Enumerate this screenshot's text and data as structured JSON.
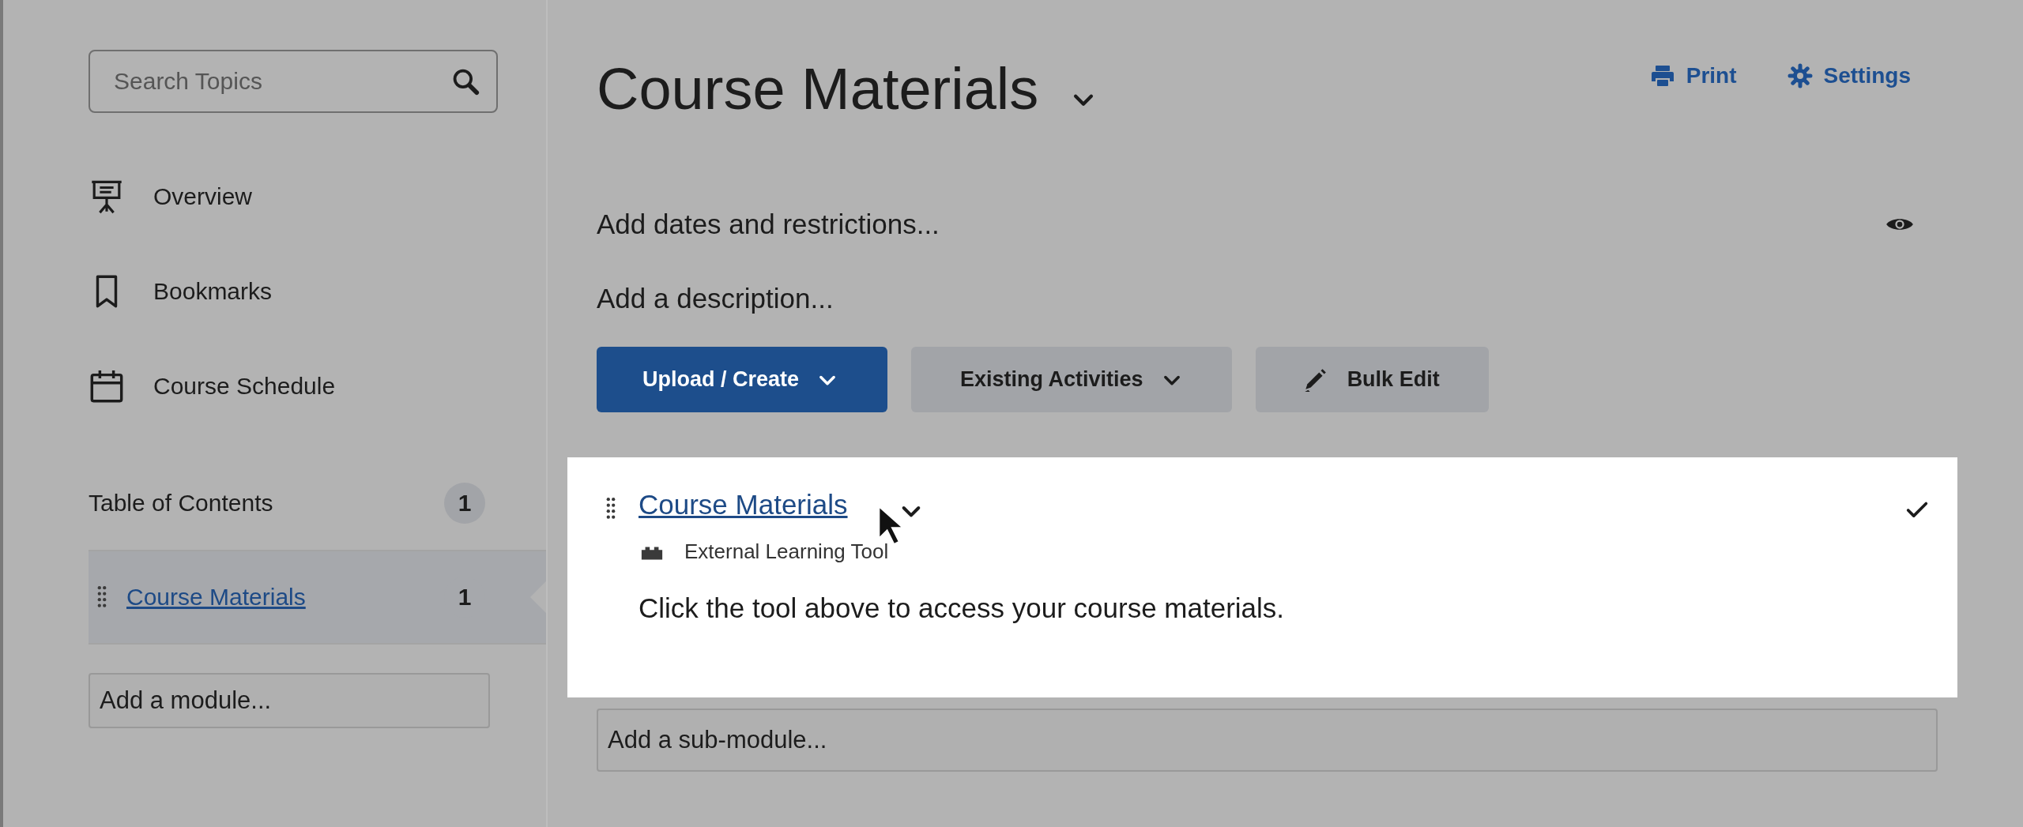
{
  "sidebar": {
    "search": {
      "placeholder": "Search Topics"
    },
    "nav_items": [
      {
        "kind": "overview",
        "label": "Overview"
      },
      {
        "kind": "bookmarks",
        "label": "Bookmarks"
      },
      {
        "kind": "schedule",
        "label": "Course Schedule"
      }
    ],
    "table_of_contents": {
      "label": "Table of Contents",
      "count": "1"
    },
    "modules": [
      {
        "title": "Course Materials",
        "count": "1",
        "selected": true
      }
    ],
    "add_module": {
      "placeholder": "Add a module..."
    }
  },
  "main": {
    "title": "Course Materials",
    "actions": [
      {
        "kind": "print",
        "label": "Print"
      },
      {
        "kind": "settings",
        "label": "Settings"
      }
    ],
    "dates_link": "Add dates and restrictions...",
    "description_link": "Add a description...",
    "buttons": [
      {
        "kind": "primary",
        "label": "Upload / Create",
        "dropdown": true
      },
      {
        "kind": "secondary",
        "label": "Existing Activities",
        "dropdown": true
      },
      {
        "kind": "bulk",
        "label": "Bulk Edit",
        "dropdown": false
      }
    ],
    "items": [
      {
        "title": "Course Materials",
        "type": "External Learning Tool",
        "description": "Click the tool above to access your course materials.",
        "completed": true
      }
    ],
    "add_submodule": {
      "placeholder": "Add a sub-module..."
    }
  }
}
